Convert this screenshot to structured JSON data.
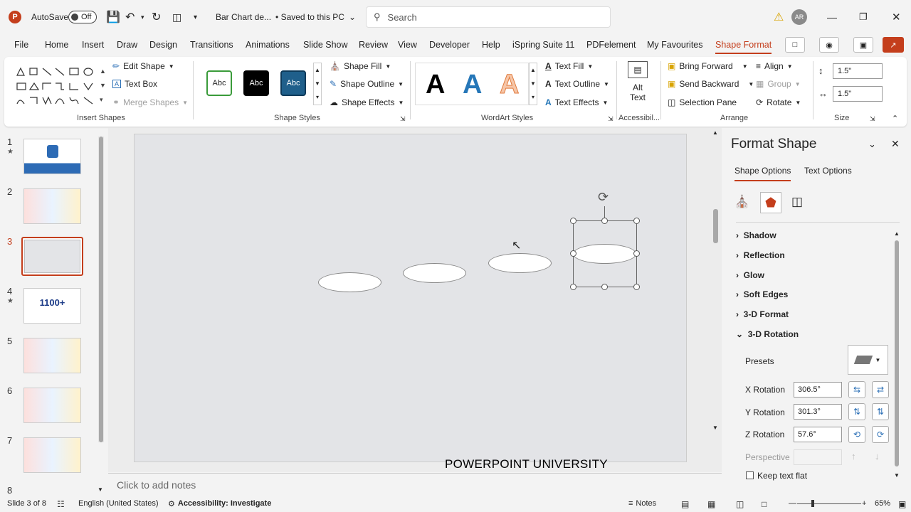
{
  "titlebar": {
    "autosave_label": "AutoSave",
    "autosave_state": "Off",
    "doc_title": "Bar Chart de...",
    "save_state": "• Saved to this PC",
    "search_placeholder": "Search",
    "user_initials": "AR"
  },
  "tabs": [
    "File",
    "Home",
    "Insert",
    "Draw",
    "Design",
    "Transitions",
    "Animations",
    "Slide Show",
    "Review",
    "View",
    "Developer",
    "Help",
    "iSpring Suite 11",
    "PDFelement",
    "My Favourites",
    "Shape Format"
  ],
  "ribbon": {
    "insert_shapes": {
      "edit_shape": "Edit Shape",
      "text_box": "Text Box",
      "merge_shapes": "Merge Shapes",
      "label": "Insert Shapes"
    },
    "shape_styles": {
      "samples": [
        "Abc",
        "Abc",
        "Abc"
      ],
      "shape_fill": "Shape Fill",
      "shape_outline": "Shape Outline",
      "shape_effects": "Shape Effects",
      "label": "Shape Styles"
    },
    "wordart": {
      "samples": [
        "A",
        "A",
        "A"
      ],
      "text_fill": "Text Fill",
      "text_outline": "Text Outline",
      "text_effects": "Text Effects",
      "label": "WordArt Styles"
    },
    "accessibility": {
      "alt_text_1": "Alt",
      "alt_text_2": "Text",
      "label": "Accessibil..."
    },
    "arrange": {
      "bring_forward": "Bring Forward",
      "send_backward": "Send Backward",
      "selection_pane": "Selection Pane",
      "align": "Align",
      "group": "Group",
      "rotate": "Rotate",
      "label": "Arrange"
    },
    "size": {
      "height": "1.5\"",
      "width": "1.5\"",
      "label": "Size"
    }
  },
  "slides": {
    "numbers": [
      "1",
      "2",
      "3",
      "4",
      "5",
      "6",
      "7",
      "8"
    ],
    "selected": "3",
    "thumb4_text": "1100+"
  },
  "notes_placeholder": "Click to add notes",
  "watermark": "POWERPOINT UNIVERSITY",
  "format_pane": {
    "title": "Format Shape",
    "tab_shape": "Shape Options",
    "tab_text": "Text Options",
    "sections": [
      "Shadow",
      "Reflection",
      "Glow",
      "Soft Edges",
      "3-D Format",
      "3-D Rotation"
    ],
    "presets_label": "Presets",
    "x_rotation_label": "X Rotation",
    "x_rotation": "306.5°",
    "y_rotation_label": "Y Rotation",
    "y_rotation": "301.3°",
    "z_rotation_label": "Z Rotation",
    "z_rotation": "57.6°",
    "perspective_label": "Perspective",
    "keep_flat_label": "Keep text flat"
  },
  "status": {
    "slide_info": "Slide 3 of 8",
    "language": "English (United States)",
    "accessibility": "Accessibility: Investigate",
    "notes": "Notes",
    "zoom": "65%"
  },
  "colors": {
    "accent": "#c43e1c",
    "style1_border": "#3a9b3a",
    "style3_fill": "#1f5f8b"
  }
}
